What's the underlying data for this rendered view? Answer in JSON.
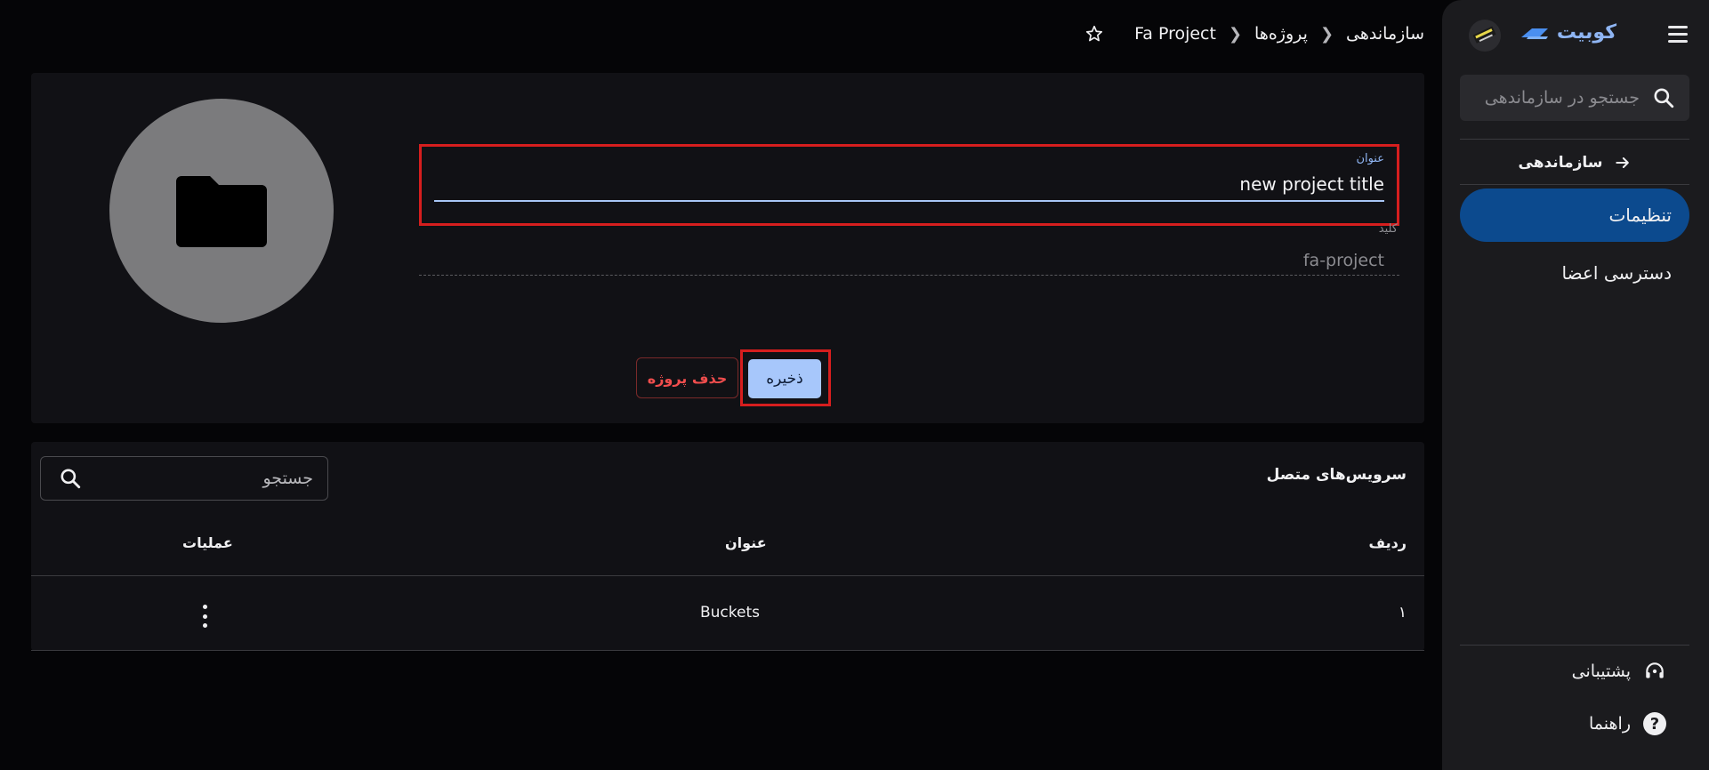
{
  "sidebar": {
    "brand_name": "کوبیت",
    "search_placeholder": "جستجو در سازماندهی",
    "org_link_label": "سازماندهی",
    "nav_items": [
      {
        "label": "تنظیمات",
        "active": true
      },
      {
        "label": "دسترسی اعضا",
        "active": false
      }
    ],
    "bottom_items": [
      {
        "label": "پشتیبانی",
        "icon": "headset-icon"
      },
      {
        "label": "راهنما",
        "icon": "help-icon"
      }
    ]
  },
  "breadcrumb": {
    "items": [
      "سازماندهی",
      "پروژه‌ها",
      "Fa Project"
    ]
  },
  "project_form": {
    "title_label": "عنوان",
    "title_value": "new project title",
    "key_label": "کلید",
    "key_value": "fa-project",
    "save_label": "ذخیره",
    "delete_label": "حذف پروژه"
  },
  "services": {
    "title": "سرویس‌های متصل",
    "search_placeholder": "جستجو",
    "columns": [
      "ردیف",
      "عنوان",
      "عملیات"
    ],
    "rows": [
      {
        "index": "۱",
        "title": "Buckets"
      }
    ]
  },
  "colors": {
    "accent": "#0c4a8e",
    "primary_button": "#a7c7fb",
    "danger": "#ef4d4d",
    "highlight": "#d61e1e"
  }
}
